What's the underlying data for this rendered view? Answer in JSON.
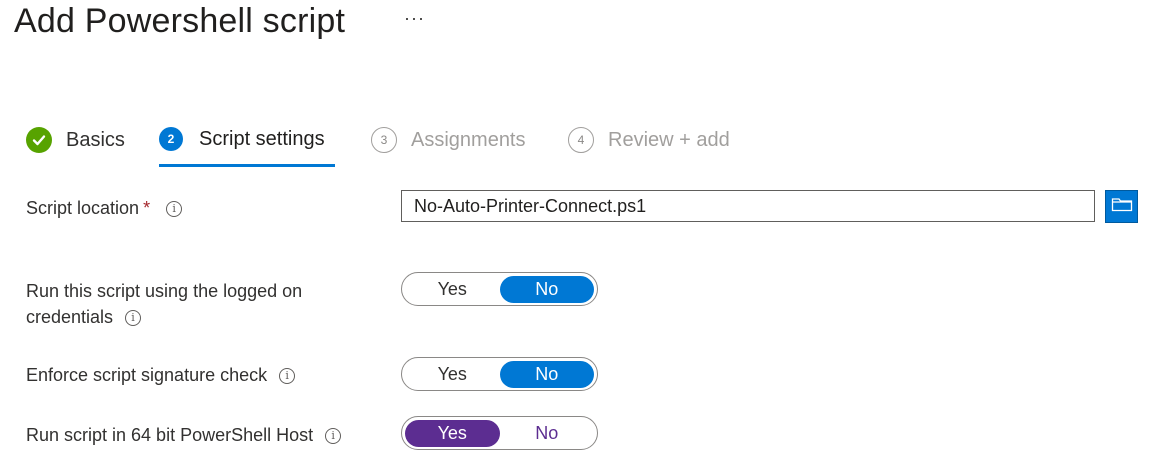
{
  "page": {
    "title": "Add Powershell script",
    "more_label": "···"
  },
  "steps": [
    {
      "number": "✓",
      "label": "Basics",
      "state": "completed"
    },
    {
      "number": "2",
      "label": "Script settings",
      "state": "active"
    },
    {
      "number": "3",
      "label": "Assignments",
      "state": "future"
    },
    {
      "number": "4",
      "label": "Review + add",
      "state": "future"
    }
  ],
  "fields": {
    "script_location": {
      "label": "Script location",
      "required_mark": "*",
      "info_icon": "i",
      "value": "No-Auto-Printer-Connect.ps1",
      "browse_icon": "folder-icon"
    },
    "logged_on": {
      "label_line1": "Run this script using the logged on",
      "label_line2": "credentials",
      "info_icon": "i",
      "yes": "Yes",
      "no": "No",
      "selected": "No"
    },
    "signature": {
      "label": "Enforce script signature check",
      "info_icon": "i",
      "yes": "Yes",
      "no": "No",
      "selected": "No"
    },
    "bit64": {
      "label": "Run script in 64 bit PowerShell Host",
      "info_icon": "i",
      "yes": "Yes",
      "no": "No",
      "selected": "Yes"
    }
  },
  "colors": {
    "accent": "#0078d4",
    "success": "#57a300",
    "toggle_purple": "#5c2d91",
    "required": "#a4262c"
  }
}
